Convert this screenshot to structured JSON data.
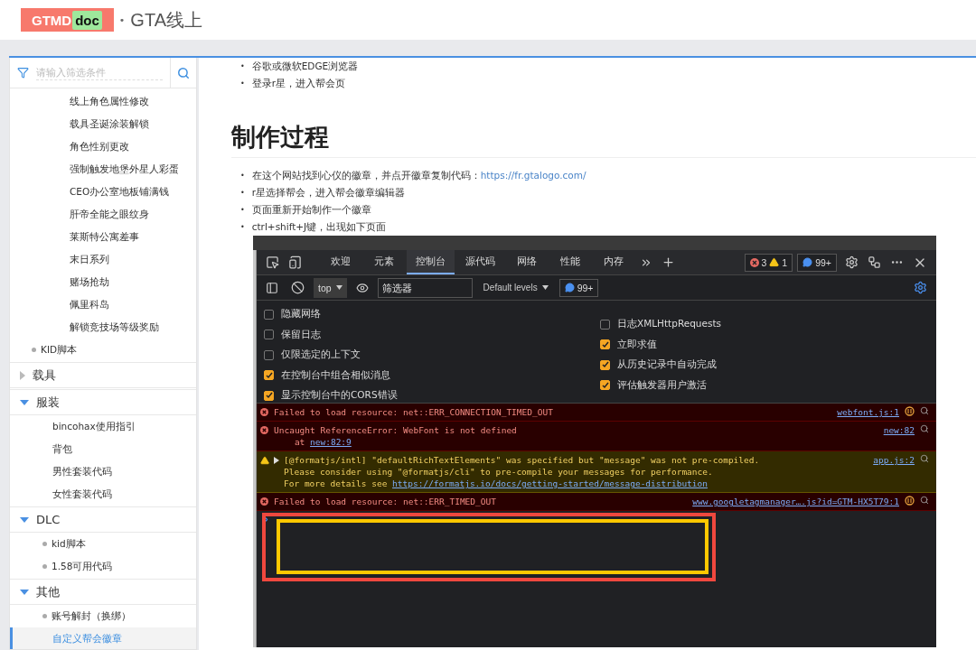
{
  "header": {
    "logo_left": "GTMD",
    "logo_right": "doc",
    "separator": "•",
    "title": "GTA线上"
  },
  "sidebar": {
    "filter": {
      "placeholder": "请输入筛选条件"
    },
    "items": [
      {
        "kind": "sub",
        "label": "线上角色属性修改",
        "selected": false
      },
      {
        "kind": "sub",
        "label": "载具圣诞涂装解锁",
        "selected": false
      },
      {
        "kind": "sub",
        "label": "角色性别更改",
        "selected": false
      },
      {
        "kind": "sub",
        "label": "强制触发地堡外星人彩蛋",
        "selected": false
      },
      {
        "kind": "sub",
        "label": "CEO办公室地板铺满钱",
        "selected": false
      },
      {
        "kind": "sub",
        "label": "肝帝全能之眼纹身",
        "selected": false
      },
      {
        "kind": "sub",
        "label": "莱斯特公寓差事",
        "selected": false
      },
      {
        "kind": "sub",
        "label": "末日系列",
        "selected": false
      },
      {
        "kind": "sub",
        "label": "赌场抢劫",
        "selected": false
      },
      {
        "kind": "sub",
        "label": "佩里科岛",
        "selected": false
      },
      {
        "kind": "sub",
        "label": "解锁竞技场等级奖励",
        "selected": false
      },
      {
        "kind": "leaf",
        "label": "KID脚本",
        "bullet": true,
        "selected": false
      },
      {
        "kind": "group",
        "label": "载具",
        "expanded": false
      },
      {
        "kind": "group",
        "label": "服装",
        "expanded": true,
        "children": [
          {
            "label": "bincohax使用指引",
            "bullet": false,
            "selected": false
          },
          {
            "label": "背包",
            "bullet": false,
            "selected": false
          },
          {
            "label": "男性套装代码",
            "bullet": false,
            "selected": false
          },
          {
            "label": "女性套装代码",
            "bullet": false,
            "selected": false
          }
        ]
      },
      {
        "kind": "group",
        "label": "DLC",
        "expanded": true,
        "children": [
          {
            "label": "kid脚本",
            "bullet": true,
            "selected": false
          },
          {
            "label": "1.58可用代码",
            "bullet": true,
            "selected": false
          }
        ]
      },
      {
        "kind": "group",
        "label": "其他",
        "expanded": true,
        "children": [
          {
            "label": "账号解封（换绑）",
            "bullet": true,
            "selected": false
          },
          {
            "label": "自定义帮会徽章",
            "bullet": false,
            "selected": true
          }
        ]
      }
    ]
  },
  "content": {
    "intro_list": [
      {
        "marker": "•",
        "text": "谷歌或微软EDGE浏览器"
      },
      {
        "marker": "•",
        "text": "登录r星，进入帮会页"
      }
    ],
    "heading": "制作过程",
    "steps": [
      {
        "marker": "•",
        "text": "在这个网站找到心仪的徽章，并点开徽章复制代码：",
        "link": "https://fr.gtalogo.com/"
      },
      {
        "marker": "•",
        "text": "r星选择帮会，进入帮会徽章编辑器"
      },
      {
        "marker": "•",
        "text": "页面重新开始制作一个徽章"
      },
      {
        "marker": "•",
        "text": "ctrl+shift+J键，出现如下页面"
      }
    ],
    "devtools": {
      "tabs": [
        {
          "label": "欢迎",
          "selected": false
        },
        {
          "label": "元素",
          "selected": false
        },
        {
          "label": "控制台",
          "selected": true
        },
        {
          "label": "源代码",
          "selected": false
        },
        {
          "label": "网络",
          "selected": false
        },
        {
          "label": "性能",
          "selected": false
        },
        {
          "label": "内存",
          "selected": false
        }
      ],
      "error_count": "3",
      "warning_count": "1",
      "message_count": "99+",
      "context": "top",
      "filter": {
        "placeholder": "筛选器"
      },
      "levels": "Default levels",
      "toolbar_message_count": "99+",
      "setting_columns": [
        {
          "items": [
            {
              "label": "隐藏网络",
              "checked": false
            },
            {
              "label": "保留日志",
              "checked": false
            },
            {
              "label": "仅限选定的上下文",
              "checked": false
            },
            {
              "label": "在控制台中组合相似消息",
              "checked": true
            },
            {
              "label": "显示控制台中的CORS错误",
              "checked": true
            }
          ]
        },
        {
          "items": [
            {
              "label": "日志XMLHttpRequests",
              "checked": false
            },
            {
              "label": "立即求值",
              "checked": true
            },
            {
              "label": "从历史记录中自动完成",
              "checked": true
            },
            {
              "label": "评估触发器用户激活",
              "checked": true
            }
          ]
        }
      ],
      "messages": [
        {
          "kind": "error",
          "expandable": false,
          "network": true,
          "source": "webfont.js:1",
          "lines": [
            {
              "text": "Failed to load resource: net::ERR_CONNECTION_TIMED_OUT"
            }
          ]
        },
        {
          "kind": "error",
          "expandable": false,
          "network": false,
          "source": "new:82",
          "lines": [
            {
              "text": "Uncaught ReferenceError: WebFont is not defined"
            },
            {
              "text": "    at ",
              "link": "new:82:9"
            }
          ]
        },
        {
          "kind": "warning",
          "expandable": true,
          "network": false,
          "source": "app.js:2",
          "lines": [
            {
              "text": "[@formatjs/intl] \"defaultRichTextElements\" was specified but \"message\" was not pre-compiled."
            },
            {
              "text": "Please consider using \"@formatjs/cli\" to pre-compile your messages for performance."
            },
            {
              "text": "For more details see ",
              "link": "https://formatjs.io/docs/getting-started/message-distribution"
            }
          ]
        },
        {
          "kind": "error",
          "expandable": false,
          "network": true,
          "source": "www.googletagmanager….js?id=GTM-HX5T79:1",
          "lines": [
            {
              "text": "Failed to load resource: net::ERR_TIMED_OUT"
            }
          ]
        }
      ]
    }
  }
}
